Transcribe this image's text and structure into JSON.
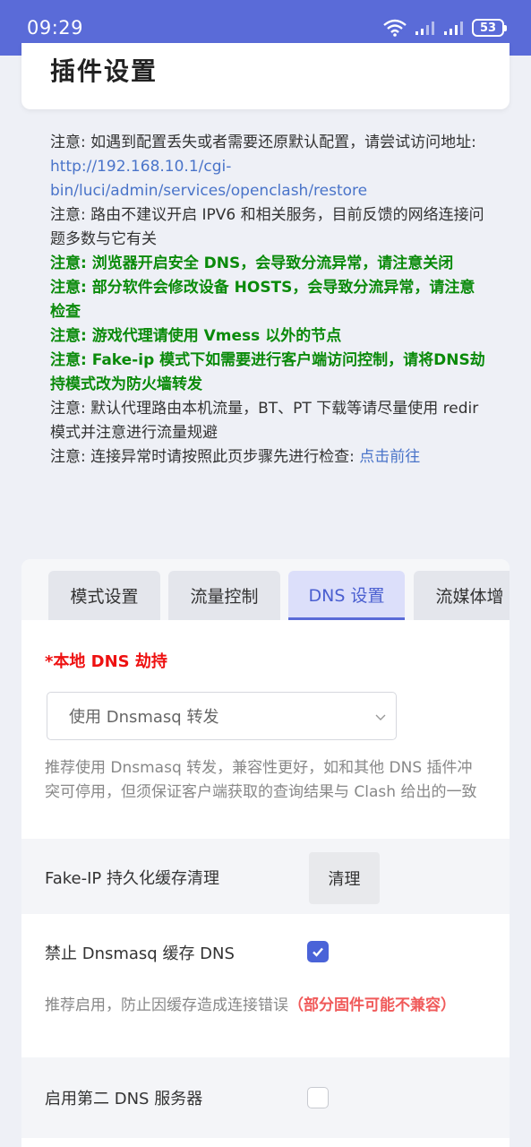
{
  "status_bar": {
    "time": "09:29",
    "battery": "53",
    "icons": [
      "wifi-icon",
      "signal-icon",
      "signal-icon",
      "battery-icon"
    ]
  },
  "page": {
    "title": "插件设置"
  },
  "notes": {
    "n1_prefix": "注意: 如遇到配置丢失或者需要还原默认配置，请尝试访问地址: ",
    "n1_link": "http://192.168.10.1/cgi-bin/luci/admin/services/openclash/restore",
    "n2": "注意: 路由不建议开启 IPV6 和相关服务，目前反馈的网络连接问题多数与它有关",
    "n3": "注意: 浏览器开启安全 DNS，会导致分流异常，请注意关闭",
    "n4": "注意: 部分软件会修改设备 HOSTS，会导致分流异常，请注意检查",
    "n5": "注意: 游戏代理请使用 Vmess 以外的节点",
    "n6": "注意: Fake-ip 模式下如需要进行客户端访问控制，请将DNS劫持模式改为防火墙转发",
    "n7": "注意: 默认代理路由本机流量，BT、PT 下载等请尽量使用 redir 模式并注意进行流量规避",
    "n8_prefix": "注意: 连接异常时请按照此页步骤先进行检查: ",
    "n8_link": "点击前往"
  },
  "tabs": [
    {
      "label": "模式设置",
      "active": false
    },
    {
      "label": "流量控制",
      "active": false
    },
    {
      "label": "DNS 设置",
      "active": true
    },
    {
      "label": "流媒体增",
      "active": false
    }
  ],
  "dns": {
    "hijack_label": "*本地 DNS 劫持",
    "hijack_value": "使用 Dnsmasq 转发",
    "hijack_help": "推荐使用 Dnsmasq 转发，兼容性更好，如和其他 DNS 插件冲突可停用，但须保证客户端获取的查询结果与 Clash 给出的一致",
    "fakeip_label": "Fake-IP 持久化缓存清理",
    "fakeip_button": "清理",
    "dnsmasq_cache_label": "禁止 Dnsmasq 缓存 DNS",
    "dnsmasq_cache_checked": true,
    "dnsmasq_cache_help": "推荐启用，防止因缓存造成连接错误",
    "dnsmasq_cache_warn": "（部分固件可能不兼容）",
    "second_dns_label": "启用第二 DNS 服务器",
    "second_dns_checked": false
  },
  "colors": {
    "accent": "#5a6bd8",
    "note_green": "#0a8a0a",
    "required_red": "#e11111",
    "warn_red": "#f05a5a",
    "link": "#4a74c9"
  }
}
